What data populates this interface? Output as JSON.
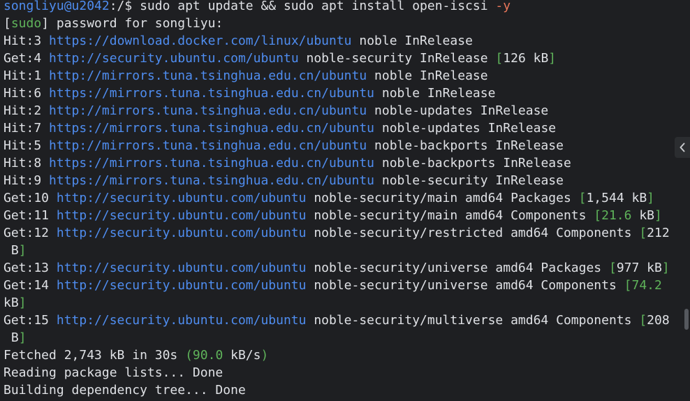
{
  "terminal": {
    "lines": [
      [
        {
          "t": "songliyu@u2042",
          "c": "user"
        },
        {
          "t": ":/$ sudo apt update && sudo apt install open-iscsi ",
          "c": "text"
        },
        {
          "t": "-y",
          "c": "orange"
        }
      ],
      [
        {
          "t": "[",
          "c": "text"
        },
        {
          "t": "sudo",
          "c": "green"
        },
        {
          "t": "] password for songliyu:",
          "c": "text"
        }
      ],
      [
        {
          "t": "Hit:3 ",
          "c": "text"
        },
        {
          "t": "https://download.docker.com/linux/ubuntu",
          "c": "url"
        },
        {
          "t": " noble InRelease",
          "c": "text"
        }
      ],
      [
        {
          "t": "Get:4 ",
          "c": "text"
        },
        {
          "t": "http://security.ubuntu.com/ubuntu",
          "c": "url"
        },
        {
          "t": " noble-security InRelease ",
          "c": "text"
        },
        {
          "t": "[",
          "c": "green"
        },
        {
          "t": "126 kB",
          "c": "text"
        },
        {
          "t": "]",
          "c": "green"
        }
      ],
      [
        {
          "t": "Hit:1 ",
          "c": "text"
        },
        {
          "t": "http://mirrors.tuna.tsinghua.edu.cn/ubuntu",
          "c": "url"
        },
        {
          "t": " noble InRelease",
          "c": "text"
        }
      ],
      [
        {
          "t": "Hit:6 ",
          "c": "text"
        },
        {
          "t": "https://mirrors.tuna.tsinghua.edu.cn/ubuntu",
          "c": "url"
        },
        {
          "t": " noble InRelease",
          "c": "text"
        }
      ],
      [
        {
          "t": "Hit:2 ",
          "c": "text"
        },
        {
          "t": "http://mirrors.tuna.tsinghua.edu.cn/ubuntu",
          "c": "url"
        },
        {
          "t": " noble-updates InRelease",
          "c": "text"
        }
      ],
      [
        {
          "t": "Hit:7 ",
          "c": "text"
        },
        {
          "t": "https://mirrors.tuna.tsinghua.edu.cn/ubuntu",
          "c": "url"
        },
        {
          "t": " noble-updates InRelease",
          "c": "text"
        }
      ],
      [
        {
          "t": "Hit:5 ",
          "c": "text"
        },
        {
          "t": "http://mirrors.tuna.tsinghua.edu.cn/ubuntu",
          "c": "url"
        },
        {
          "t": " noble-backports InRelease",
          "c": "text"
        }
      ],
      [
        {
          "t": "Hit:8 ",
          "c": "text"
        },
        {
          "t": "https://mirrors.tuna.tsinghua.edu.cn/ubuntu",
          "c": "url"
        },
        {
          "t": " noble-backports InRelease",
          "c": "text"
        }
      ],
      [
        {
          "t": "Hit:9 ",
          "c": "text"
        },
        {
          "t": "https://mirrors.tuna.tsinghua.edu.cn/ubuntu",
          "c": "url"
        },
        {
          "t": " noble-security InRelease",
          "c": "text"
        }
      ],
      [
        {
          "t": "Get:10 ",
          "c": "text"
        },
        {
          "t": "http://security.ubuntu.com/ubuntu",
          "c": "url"
        },
        {
          "t": " noble-security/main amd64 Packages ",
          "c": "text"
        },
        {
          "t": "[",
          "c": "green"
        },
        {
          "t": "1,544 kB",
          "c": "text"
        },
        {
          "t": "]",
          "c": "green"
        }
      ],
      [
        {
          "t": "Get:11 ",
          "c": "text"
        },
        {
          "t": "http://security.ubuntu.com/ubuntu",
          "c": "url"
        },
        {
          "t": " noble-security/main amd64 Components ",
          "c": "text"
        },
        {
          "t": "[21.6",
          "c": "green"
        },
        {
          "t": " kB",
          "c": "text"
        },
        {
          "t": "]",
          "c": "green"
        }
      ],
      [
        {
          "t": "Get:12 ",
          "c": "text"
        },
        {
          "t": "http://security.ubuntu.com/ubuntu",
          "c": "url"
        },
        {
          "t": " noble-security/restricted amd64 Components ",
          "c": "text"
        },
        {
          "t": "[",
          "c": "green"
        },
        {
          "t": "212",
          "c": "text"
        }
      ],
      [
        {
          "t": " B",
          "c": "text"
        },
        {
          "t": "]",
          "c": "green"
        }
      ],
      [
        {
          "t": "Get:13 ",
          "c": "text"
        },
        {
          "t": "http://security.ubuntu.com/ubuntu",
          "c": "url"
        },
        {
          "t": " noble-security/universe amd64 Packages ",
          "c": "text"
        },
        {
          "t": "[",
          "c": "green"
        },
        {
          "t": "977 kB",
          "c": "text"
        },
        {
          "t": "]",
          "c": "green"
        }
      ],
      [
        {
          "t": "Get:14 ",
          "c": "text"
        },
        {
          "t": "http://security.ubuntu.com/ubuntu",
          "c": "url"
        },
        {
          "t": " noble-security/universe amd64 Components ",
          "c": "text"
        },
        {
          "t": "[74.2",
          "c": "green"
        }
      ],
      [
        {
          "t": "kB",
          "c": "text"
        },
        {
          "t": "]",
          "c": "green"
        }
      ],
      [
        {
          "t": "Get:15 ",
          "c": "text"
        },
        {
          "t": "http://security.ubuntu.com/ubuntu",
          "c": "url"
        },
        {
          "t": " noble-security/multiverse amd64 Components ",
          "c": "text"
        },
        {
          "t": "[",
          "c": "green"
        },
        {
          "t": "208",
          "c": "text"
        }
      ],
      [
        {
          "t": " B",
          "c": "text"
        },
        {
          "t": "]",
          "c": "green"
        }
      ],
      [
        {
          "t": "Fetched 2,743 kB in 30s ",
          "c": "text"
        },
        {
          "t": "(90.0",
          "c": "green"
        },
        {
          "t": " kB/s",
          "c": "text"
        },
        {
          "t": ")",
          "c": "green"
        }
      ],
      [
        {
          "t": "Reading package lists... Done",
          "c": "text"
        }
      ],
      [
        {
          "t": "Building dependency tree... Done",
          "c": "text"
        }
      ]
    ],
    "colors": {
      "background": "#1e1f22",
      "text": "#dfe1e5",
      "user": "#4f8df0",
      "url": "#4f8df0",
      "green": "#5fb35a",
      "orange": "#e8765a"
    },
    "side_toggle_icon": "chevron-left-icon"
  }
}
